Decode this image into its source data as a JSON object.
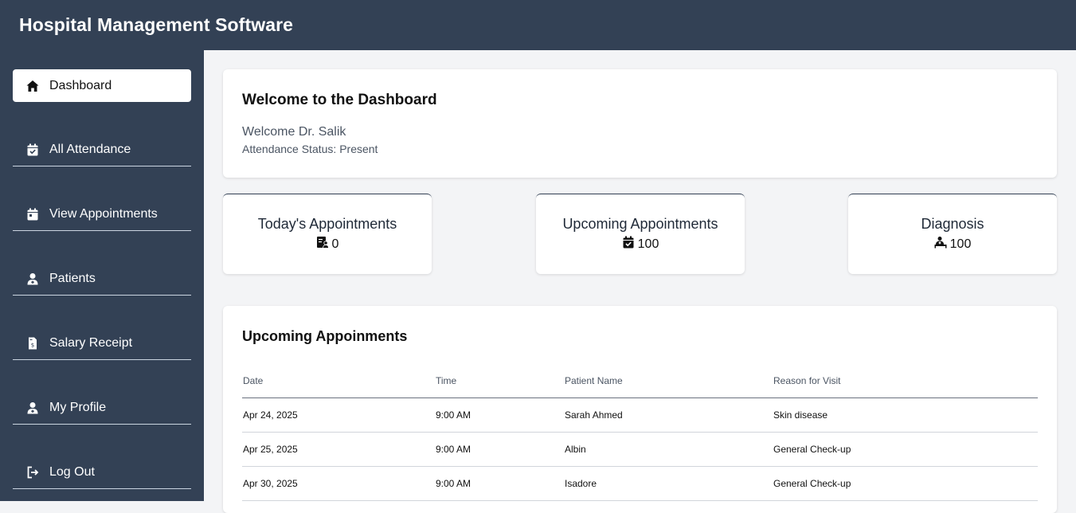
{
  "app": {
    "title": "Hospital Management Software"
  },
  "sidebar": {
    "items": [
      {
        "label": "Dashboard",
        "icon": "home-icon",
        "active": true
      },
      {
        "label": "All Attendance",
        "icon": "calendar-check-icon"
      },
      {
        "label": "View Appointments",
        "icon": "calendar-icon"
      },
      {
        "label": "Patients",
        "icon": "user-doctor-icon"
      },
      {
        "label": "Salary Receipt",
        "icon": "receipt-icon"
      },
      {
        "label": "My Profile",
        "icon": "user-doctor-icon"
      },
      {
        "label": "Log Out",
        "icon": "logout-icon"
      }
    ]
  },
  "welcome": {
    "title": "Welcome to the Dashboard",
    "greeting": "Welcome Dr. Salik",
    "status": "Attendance Status: Present"
  },
  "stats": [
    {
      "title": "Today's Appointments",
      "value": "0",
      "icon": "clipboard-user-icon"
    },
    {
      "title": "Upcoming Appointments",
      "value": "100",
      "icon": "calendar-check-icon"
    },
    {
      "title": "Diagnosis",
      "value": "100",
      "icon": "bed-pulse-icon"
    }
  ],
  "appointments": {
    "title": "Upcoming Appoinments",
    "columns": [
      "Date",
      "Time",
      "Patient Name",
      "Reason for Visit"
    ],
    "rows": [
      [
        "Apr 24, 2025",
        "9:00 AM",
        "Sarah Ahmed",
        "Skin disease"
      ],
      [
        "Apr 25, 2025",
        "9:00 AM",
        "Albin",
        "General Check-up"
      ],
      [
        "Apr 30, 2025",
        "9:00 AM",
        "Isadore",
        "General Check-up"
      ]
    ]
  }
}
